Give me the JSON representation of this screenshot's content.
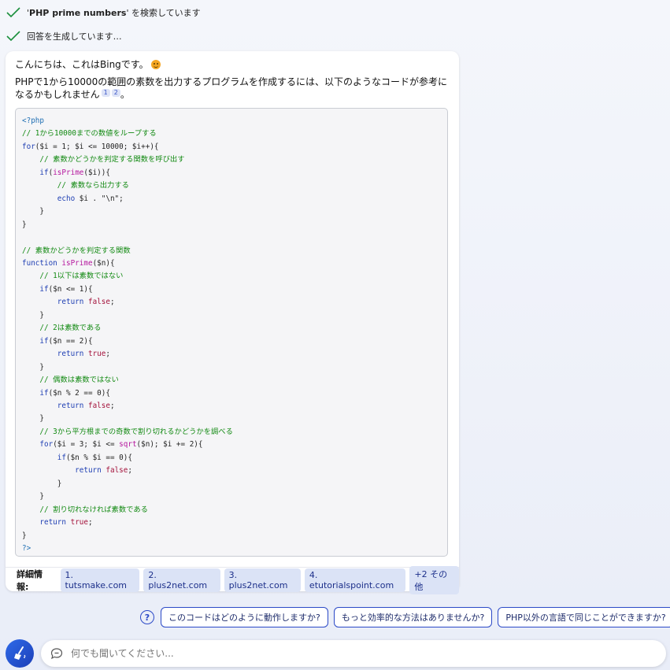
{
  "status": {
    "search_prefix": "'",
    "search_term": "PHP prime numbers",
    "search_suffix": "' を検索しています",
    "generating": "回答を生成しています…"
  },
  "message": {
    "greeting": "こんにちは、これはBingです。",
    "intro": "PHPで1から10000の範囲の素数を出力するプログラムを作成するには、以下のようなコードが参考になるかもしれません",
    "cite1": "1",
    "cite2": "2",
    "intro_end": "。"
  },
  "code": {
    "open_tag": "<?php",
    "c1": "// 1から10000までの数値をループする",
    "for1_kw": "for",
    "for1_rest": "($i = 1; $i <= 10000; $i++){",
    "c2": "// 素数かどうかを判定する関数を呼び出す",
    "if1_kw": "if",
    "if1_fn": "isPrime",
    "if1_rest": "($i)){",
    "c3": "// 素数なら出力する",
    "echo_kw": "echo",
    "echo_rest": " $i . \"\\n\";",
    "c4": "// 素数かどうかを判定する関数",
    "func_kw": "function",
    "func_name": "isPrime",
    "func_rest": "($n){",
    "c5": "// 1以下は素数ではない",
    "if2": "($n <= 1){",
    "return_kw": "return",
    "false_lit": "false",
    "true_lit": "true",
    "c6": "// 2は素数である",
    "if3": "($n == 2){",
    "c7": "// 偶数は素数ではない",
    "if4": "($n % 2 == 0){",
    "c8": "// 3から平方根までの奇数で割り切れるかどうかを調べる",
    "for2_rest_a": "($i = 3; $i <= ",
    "sqrt_fn": "sqrt",
    "for2_rest_b": "($n); $i += 2){",
    "if5": "($n % $i == 0){",
    "c9": "// 割り切れなければ素数である",
    "close_tag": "?>"
  },
  "learn_more": {
    "label": "詳細情報:",
    "links": [
      "1. tutsmake.com",
      "2. plus2net.com",
      "3. plus2net.com",
      "4. etutorialspoint.com",
      "+2 その他"
    ]
  },
  "suggestions": [
    "このコードはどのように動作しますか?",
    "もっと効率的な方法はありませんか?",
    "PHP以外の言語で同じことができますか?"
  ],
  "input": {
    "placeholder": "何でも聞いてください..."
  },
  "colors": {
    "accent": "#2b49c7",
    "check": "#1a8f3c",
    "chip_bg": "#dbe3f6"
  }
}
